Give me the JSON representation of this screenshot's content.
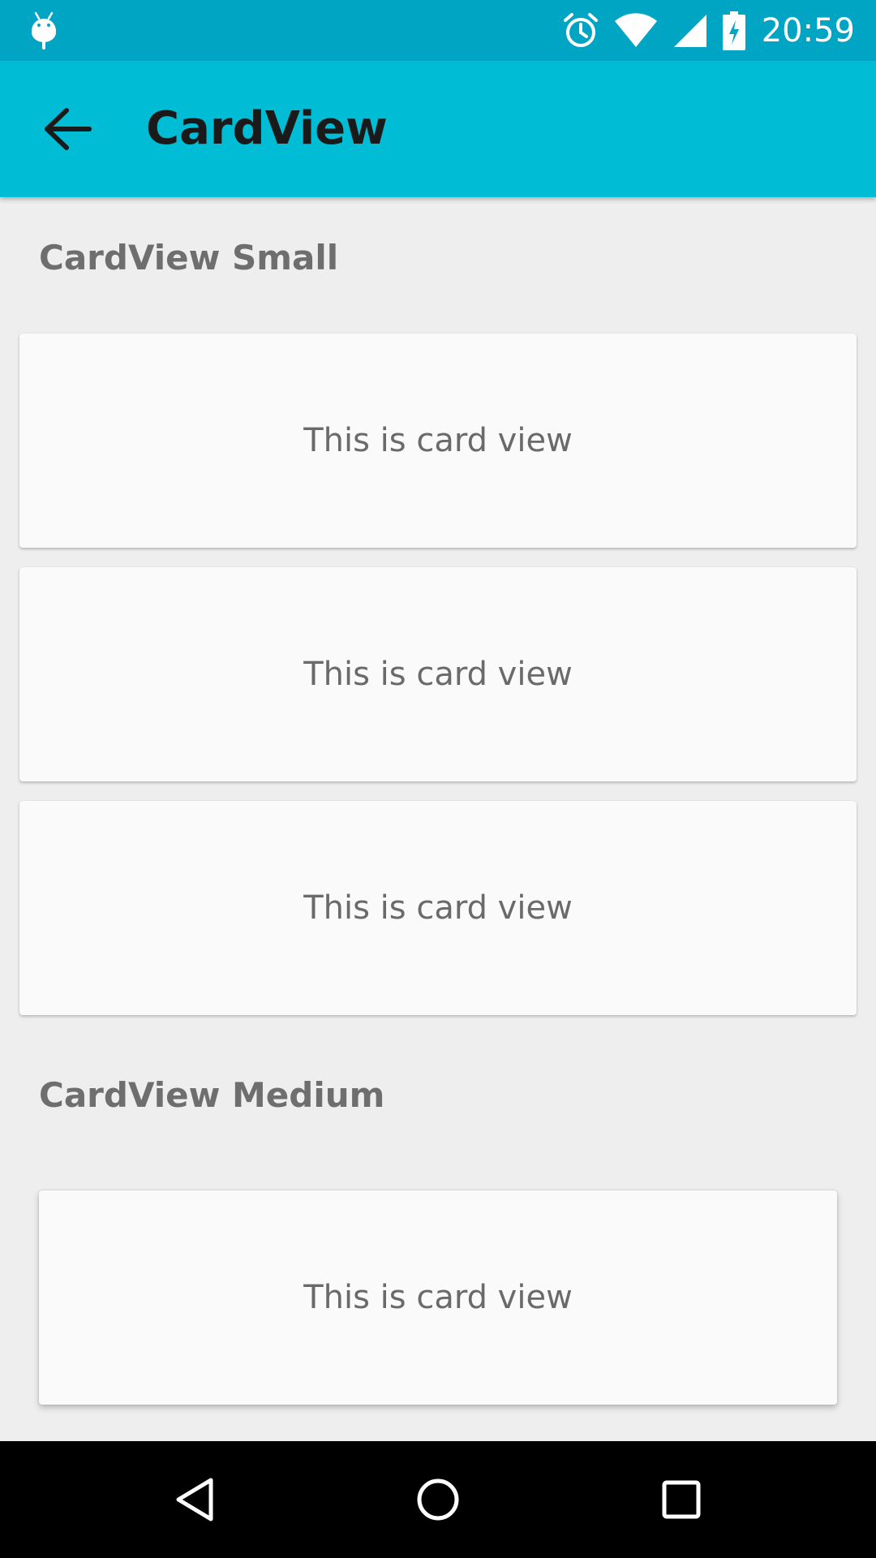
{
  "status_bar": {
    "time": "20:59",
    "icons": [
      "android-icon",
      "alarm-icon",
      "wifi-icon",
      "signal-icon",
      "battery-charging-icon"
    ]
  },
  "app_bar": {
    "title": "CardView",
    "nav_icon": "arrow-back-icon"
  },
  "sections": [
    {
      "title": "CardView Small",
      "cards": [
        {
          "text": "This is card view"
        },
        {
          "text": "This is card view"
        },
        {
          "text": "This is card view"
        }
      ]
    },
    {
      "title": "CardView Medium",
      "cards": [
        {
          "text": "This is card view"
        }
      ]
    }
  ],
  "nav_bar": {
    "icons": [
      "back-icon",
      "home-icon",
      "recents-icon"
    ]
  },
  "colors": {
    "status_bar": "#00A5C4",
    "app_bar": "#00BCD4",
    "background": "#EEEEEE",
    "card": "#FAFAFA",
    "nav_bar": "#000000"
  }
}
